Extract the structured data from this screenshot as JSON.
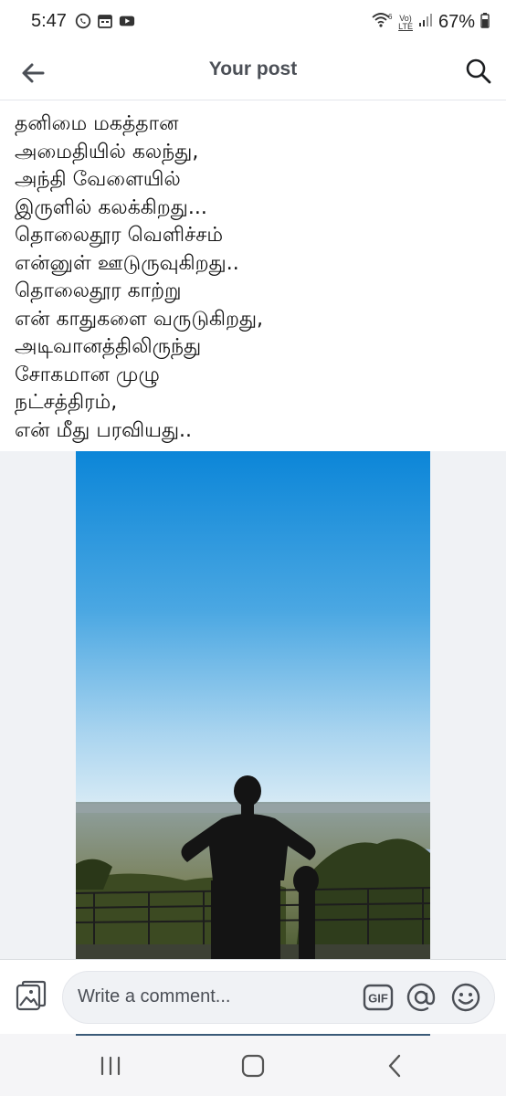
{
  "status_bar": {
    "time": "5:47",
    "network_badge_top": "Vo)",
    "network_badge_bottom": "LTE",
    "battery_percent": "67%",
    "icons": [
      "whatsapp-icon",
      "calendar-icon",
      "youtube-icon",
      "wifi-icon",
      "signal-icon",
      "battery-icon"
    ]
  },
  "header": {
    "title": "Your post",
    "icons": [
      "back-arrow-icon",
      "search-icon"
    ]
  },
  "post": {
    "lines": [
      "தனிமை மகத்தான",
      "அமைதியில் கலந்து,",
      "அந்தி வேளையில்",
      "இருளில் கலக்கிறது...",
      "தொலைதூர வெளிச்சம்",
      "என்னுள் ஊடுருவுகிறது..",
      "தொலைதூர காற்று",
      "என் காதுகளை வருடுகிறது,",
      "அடிவானத்திலிருந்து",
      "சோகமான முழு",
      "நட்சத்திரம்,",
      "என் மீது பரவியது.."
    ]
  },
  "comment_bar": {
    "placeholder": "Write a comment...",
    "gif_label": "GIF",
    "icons": [
      "photo-gallery-icon",
      "gif-icon",
      "at-mention-icon",
      "emoji-icon"
    ]
  },
  "nav_bar": {
    "icons": [
      "recent-apps-icon",
      "home-icon",
      "back-icon"
    ]
  },
  "colors": {
    "sky_top": "#0c86d8",
    "sky_bottom": "#cfe6f5",
    "background": "#f0f2f5",
    "text": "#111111"
  }
}
